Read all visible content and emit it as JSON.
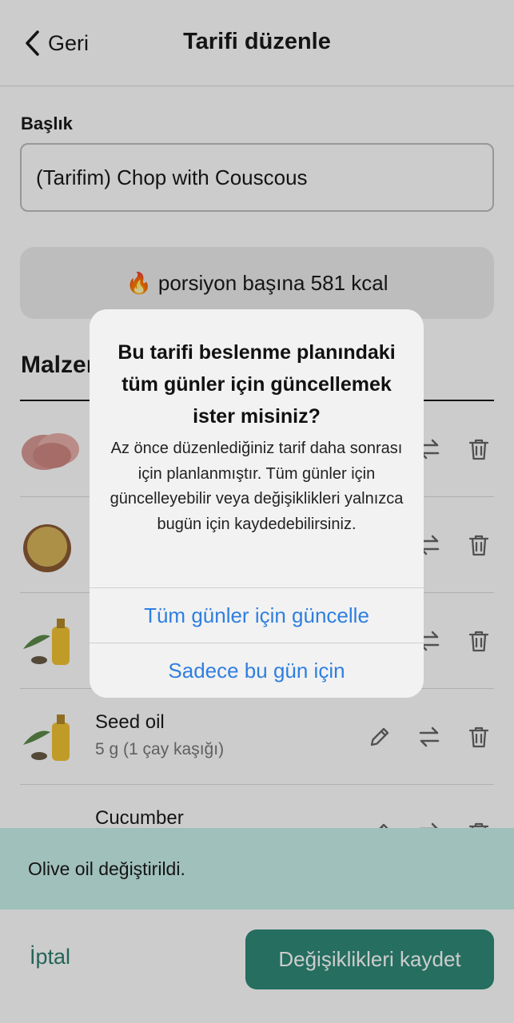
{
  "header": {
    "back_label": "Geri",
    "title": "Tarifi düzenle"
  },
  "form": {
    "title_label": "Başlık",
    "title_value": "(Tarifim) Chop with Couscous",
    "kcal_text": "porsiyon başına 581 kcal",
    "section_title": "Malzemeler"
  },
  "ingredients": [
    {
      "name": "",
      "amount": "",
      "image": "pork-chop"
    },
    {
      "name": "",
      "amount": "",
      "image": "couscous"
    },
    {
      "name": "",
      "amount": "",
      "image": "seed-oil"
    },
    {
      "name": "Seed oil",
      "amount": "5 g (1 çay kaşığı)",
      "image": "seed-oil"
    },
    {
      "name": "Cucumber",
      "amount": "",
      "image": "cucumber"
    }
  ],
  "toast": {
    "text": "Olive oil değiştirildi."
  },
  "footer": {
    "cancel_label": "İptal",
    "save_label": "Değişiklikleri kaydet"
  },
  "alert": {
    "title": "Bu tarifi beslenme planındaki tüm günler için güncellemek ister misiniz?",
    "message": "Az önce düzenlediğiniz tarif daha sonrası için planlanmıştır. Tüm günler için güncelleyebilir veya değişiklikleri yalnızca bugün için kaydedebilirsiniz.",
    "primary_button": "Tüm günler için güncelle",
    "secondary_button": "Sadece bu gün için"
  },
  "colors": {
    "accent_teal": "#2f8a78",
    "toast_bg": "#c9f0ea",
    "ios_blue": "#2f7fe0",
    "overlay": "rgba(0,0,0,0.2)"
  }
}
